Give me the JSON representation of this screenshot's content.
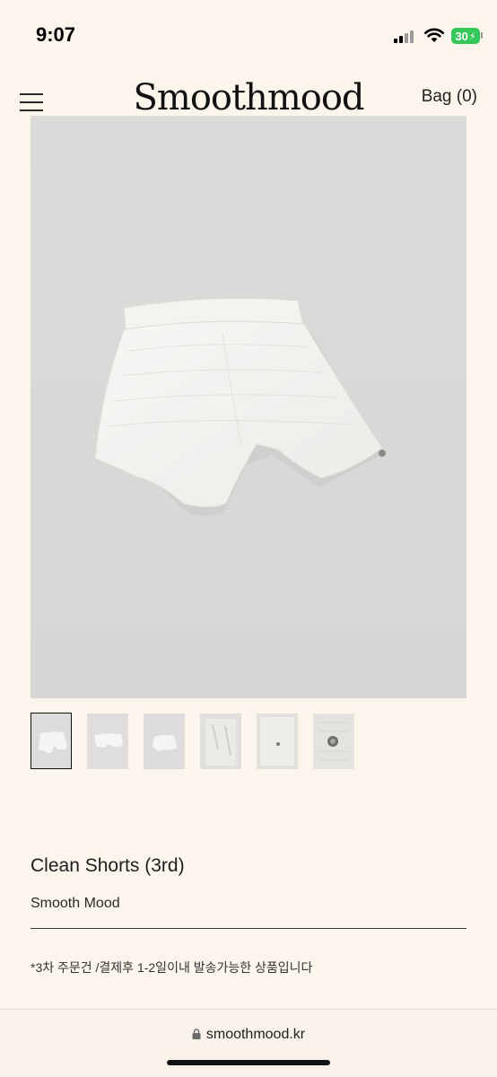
{
  "status_bar": {
    "time": "9:07",
    "battery": "30",
    "icons": [
      "cellular-signal-icon",
      "wifi-icon",
      "battery-charging-icon"
    ]
  },
  "header": {
    "logo": "Smoothmood",
    "bag_label": "Bag (0)",
    "menu_icon": "hamburger-menu-icon"
  },
  "gallery": {
    "thumbnail_count": 6,
    "selected_index": 0
  },
  "product": {
    "title": "Clean Shorts (3rd)",
    "brand": "Smooth Mood",
    "notice": "*3차 주문건 /결제후 1-2일이내 발송가능한 상품입니다"
  },
  "browser": {
    "url": "smoothmood.kr"
  },
  "colors": {
    "page_background": "#fcf5ec",
    "image_background": "#d9d9d8",
    "battery_green": "#34c759"
  }
}
